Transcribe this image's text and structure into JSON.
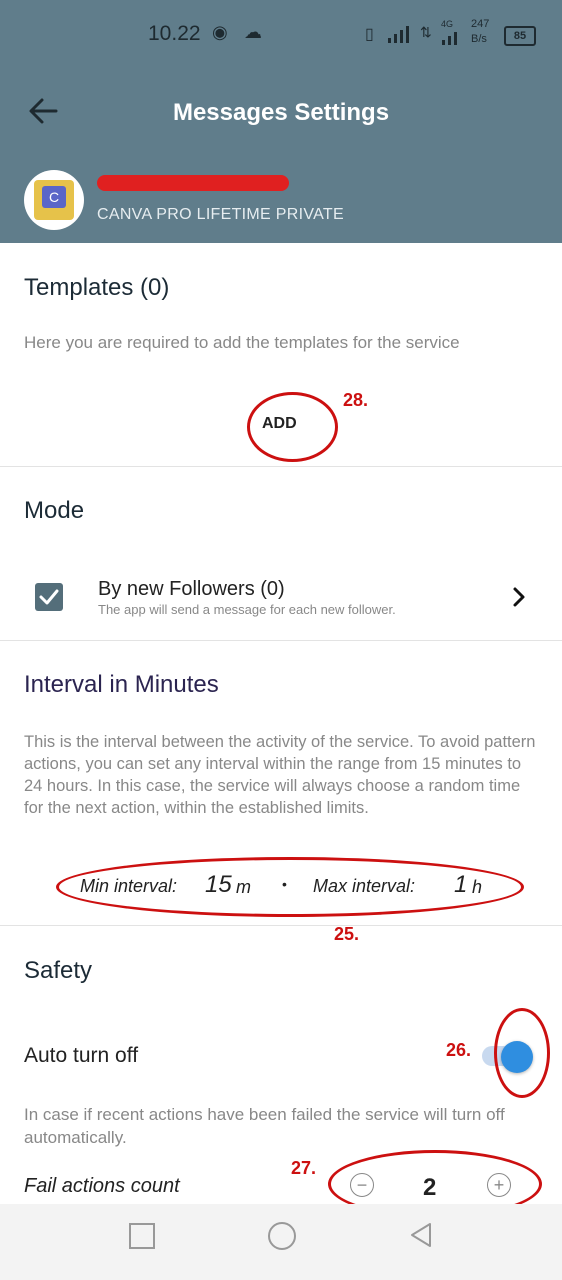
{
  "status_bar": {
    "time": "10.22",
    "network_1": "4G",
    "speed_value": "247",
    "speed_unit": "B/s",
    "battery": "85"
  },
  "header": {
    "title": "Messages Settings",
    "account_subtitle": "CANVA PRO LIFETIME PRIVATE"
  },
  "templates": {
    "title": "Templates (0)",
    "description": "Here you are required to add the templates for the service",
    "add_label": "ADD",
    "annotation": "28."
  },
  "mode": {
    "title": "Mode",
    "item_title": "By new Followers (0)",
    "item_subtitle": "The app will send a message for each new follower.",
    "checked": true
  },
  "interval": {
    "title": "Interval in Minutes",
    "description": "This is the interval between the activity of the service. To avoid pattern actions, you can set any interval within the range from 15 minutes to 24 hours. In this case, the service will always choose a random time for the next action, within the established limits.",
    "min_label": "Min interval:",
    "min_value": "15",
    "min_unit": "m",
    "separator": "•",
    "max_label": "Max interval:",
    "max_value": "1",
    "max_unit": "h",
    "annotation": "25."
  },
  "safety": {
    "title": "Safety",
    "auto_off_label": "Auto turn off",
    "auto_off_enabled": true,
    "toggle_annotation": "26.",
    "description": "In case if recent actions have been failed the service will turn off automatically.",
    "fail_count_label": "Fail actions count",
    "fail_count_value": "2",
    "minus": "−",
    "plus": "+",
    "stepper_annotation": "27."
  },
  "colors": {
    "header_bg": "#607d8b",
    "accent": "#2f8ee0",
    "annotation_red": "#cc1010"
  }
}
